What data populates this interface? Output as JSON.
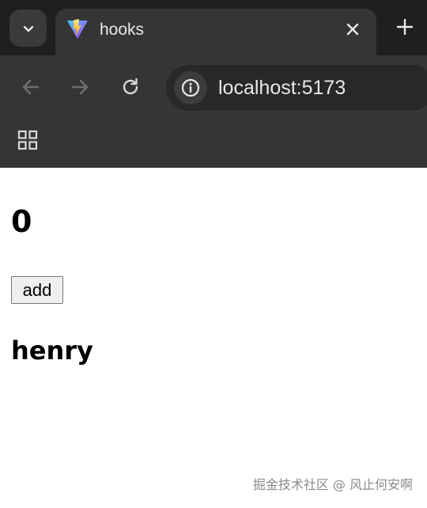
{
  "browser": {
    "tab": {
      "title": "hooks",
      "favicon": "vite-logo-icon"
    },
    "address": {
      "url": "localhost:5173"
    },
    "icons": {
      "tab_search": "chevron-down-icon",
      "close": "close-icon",
      "new_tab": "plus-icon",
      "back": "arrow-left-icon",
      "forward": "arrow-right-icon",
      "reload": "reload-icon",
      "site_info": "info-icon",
      "apps": "apps-grid-icon"
    },
    "colors": {
      "frame": "#1f1f1f",
      "toolbar": "#353535",
      "omnibox": "#282828"
    }
  },
  "page": {
    "count": "0",
    "add_button_label": "add",
    "name": "henry"
  },
  "watermark": {
    "text": "掘金技术社区 @ 风止何安啊"
  }
}
